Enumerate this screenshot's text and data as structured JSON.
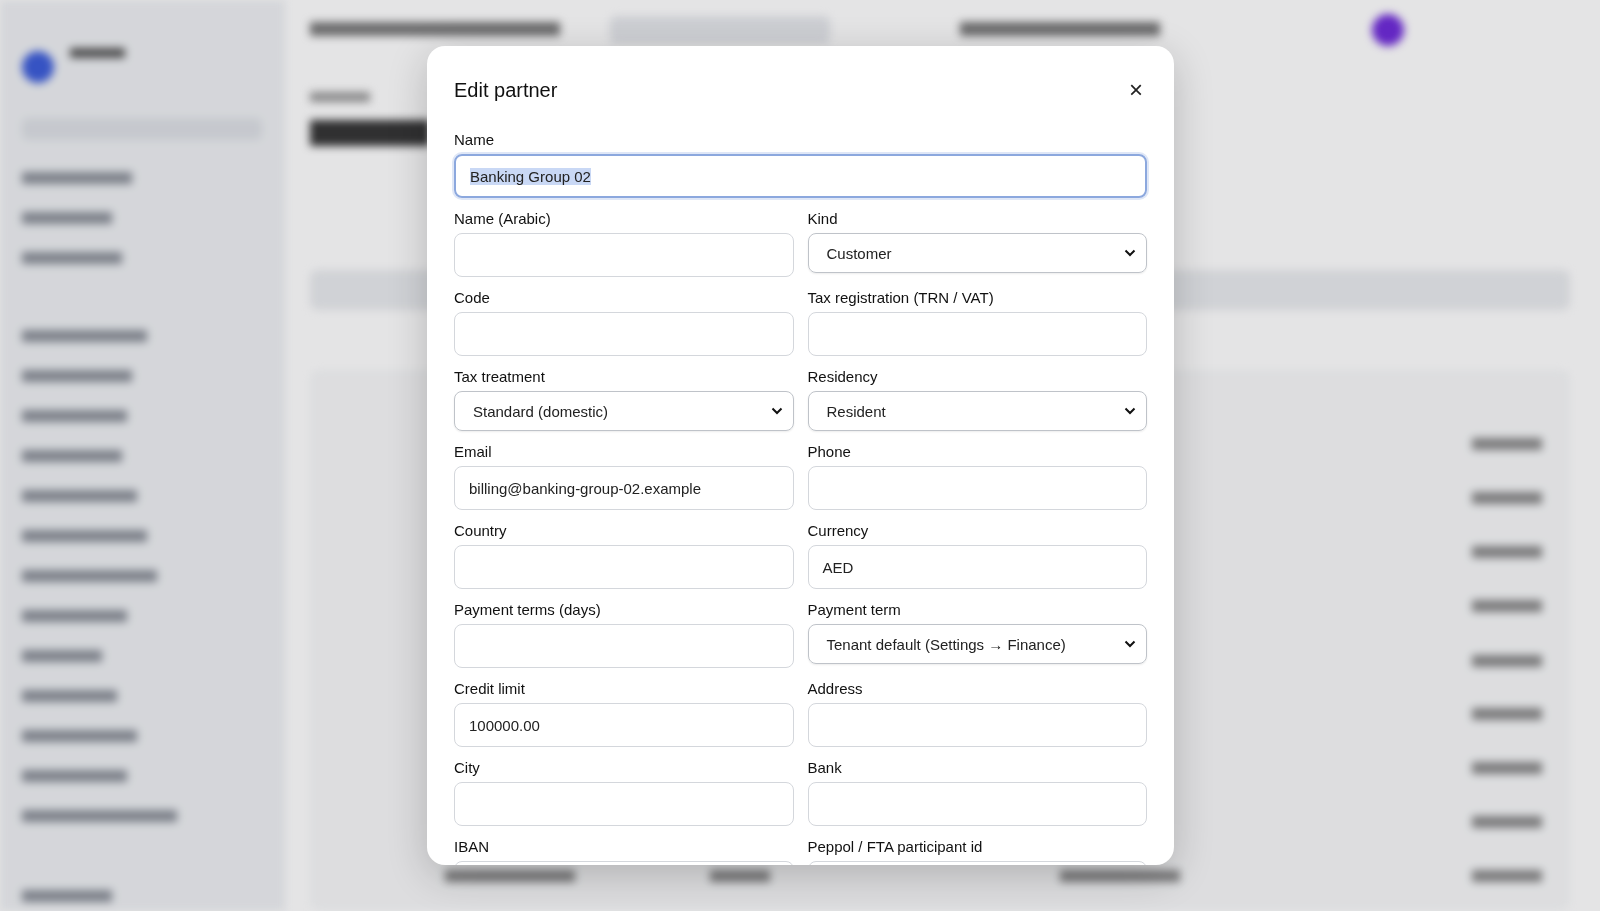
{
  "dialog": {
    "title": "Edit partner",
    "close": "×",
    "fields": [
      {
        "label": "Name",
        "kind": "input",
        "value": "Banking Group 02",
        "focused": true,
        "text_selected": true
      },
      {
        "label": "Name (Arabic)",
        "kind": "input",
        "focused": false
      },
      {
        "label": "Kind",
        "kind": "select",
        "value": "Customer",
        "focused": false
      },
      {
        "label": "Code",
        "kind": "input",
        "focused": false
      },
      {
        "label": "Tax registration (TRN / VAT)",
        "kind": "input",
        "focused": false
      },
      {
        "label": "Tax treatment",
        "kind": "select",
        "value": "Standard (domestic)",
        "focused": false
      },
      {
        "label": "Residency",
        "kind": "select",
        "value": "Resident",
        "focused": false
      },
      {
        "label": "Email",
        "kind": "input",
        "value": "billing@banking-group-02.example",
        "focused": false
      },
      {
        "label": "Phone",
        "kind": "input",
        "focused": false
      },
      {
        "label": "Country",
        "kind": "input",
        "focused": false
      },
      {
        "label": "Currency",
        "kind": "input",
        "value": "AED",
        "focused": false
      },
      {
        "label": "Payment terms (days)",
        "kind": "input",
        "focused": false
      },
      {
        "label": "Payment term",
        "kind": "select",
        "value": "Tenant default (Settings → Finance)",
        "focused": false
      },
      {
        "label": "Credit limit",
        "kind": "input",
        "value": "100000.00",
        "focused": false
      },
      {
        "label": "Address",
        "kind": "input",
        "focused": false
      },
      {
        "label": "City",
        "kind": "input",
        "focused": false
      },
      {
        "label": "Bank",
        "kind": "input",
        "focused": false
      },
      {
        "label": "IBAN",
        "kind": "input"
      },
      {
        "label": "Peppol / FTA participant id",
        "kind": "input"
      }
    ]
  }
}
